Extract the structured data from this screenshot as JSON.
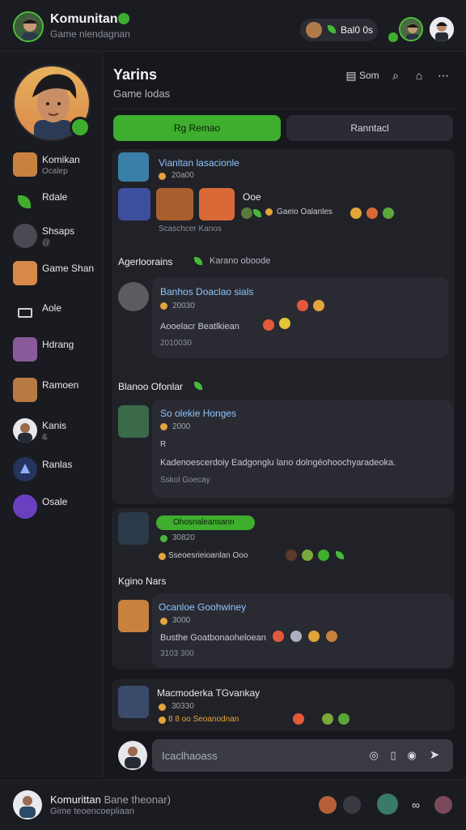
{
  "topbar": {
    "title": "Komunitan",
    "subtitle": "Game nlendagnan",
    "coins": "Bal0 0s"
  },
  "sidebar": {
    "items": [
      {
        "label": "Komikan",
        "sub": "Ocalep"
      },
      {
        "label": "Rdale",
        "sub": ""
      },
      {
        "label": "Shsaps",
        "sub": "@"
      },
      {
        "label": "Game Shan",
        "sub": ""
      },
      {
        "label": "Aole",
        "sub": ""
      },
      {
        "label": "Hdrang",
        "sub": ""
      },
      {
        "label": "Ramoen",
        "sub": ""
      },
      {
        "label": "Kanis",
        "sub": "&"
      },
      {
        "label": "Ranlas",
        "sub": ""
      },
      {
        "label": "Osale",
        "sub": ""
      }
    ]
  },
  "main": {
    "title": "Yarins",
    "subtitle": "Game lodas",
    "sort_label": "Som",
    "tabs": [
      "Rg Remao",
      "Ranntacl"
    ]
  },
  "feed": {
    "post1": {
      "name": "Vianltan lasacionle",
      "meta": "20a00",
      "gallery_label": "Ooe",
      "reactions": "Gaeio Oalanles",
      "caption": "Scaschcer Kanos"
    },
    "section1": {
      "title": "Agerloorains",
      "note": "Karano oboode"
    },
    "reply1": {
      "name": "Banhos Doaclao sials",
      "meta": "20030",
      "body": "Aooelacr Beatlkiean",
      "time": "2010030"
    },
    "section2": {
      "title": "Blanoo Ofonlar"
    },
    "reply2": {
      "name": "So olekie Honges",
      "meta": "2000",
      "extra": "R",
      "body": "Kadenoescerdoiy Eadgonglu lano dolngéohoochyaradeoka.",
      "time": "Sskol Goecay"
    },
    "post2": {
      "pill": "Ohosnaleansann",
      "meta": "30820",
      "body": "Sseoesrieioanlan Ooo"
    },
    "section3": {
      "title": "Kgino Nars"
    },
    "reply3": {
      "name": "Ocanloe Goohwiney",
      "meta": "3000",
      "body": "Busthe Goatbonaoheloean",
      "time": "3103 300"
    },
    "post3": {
      "name": "Macmoderka TGvankay",
      "meta": "30330",
      "body": "8 8 oo Seoanodnan"
    }
  },
  "composer": {
    "placeholder": "Icaclhaoass"
  },
  "bottombar": {
    "title": "Komurittan",
    "title_extra": "Bane theonar)",
    "subtitle": "Gime teoencoepliaan"
  }
}
